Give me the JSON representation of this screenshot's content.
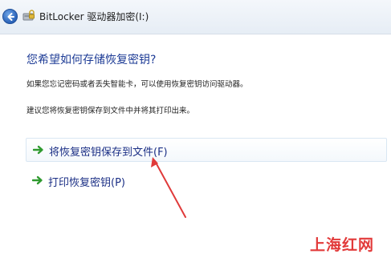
{
  "window": {
    "title": "BitLocker 驱动器加密(I:)",
    "back_icon": "back-arrow-icon",
    "app_icon": "bitlocker-icon"
  },
  "main": {
    "heading": "您希望如何存储恢复密钥?",
    "para1": "如果您忘记密码或者丢失智能卡，可以使用恢复密钥访问驱动器。",
    "para2": "建议您将恢复密钥保存到文件中并将其打印出来。",
    "options": [
      {
        "label": "将恢复密钥保存到文件(F)",
        "icon": "green-arrow-icon",
        "selected": true
      },
      {
        "label": "打印恢复密钥(P)",
        "icon": "green-arrow-icon",
        "selected": false
      }
    ]
  },
  "annotation": {
    "color": "#e03a3a"
  },
  "watermark": {
    "text": "上海红网"
  },
  "colors": {
    "heading": "#1e3c96",
    "link": "#1b2f85",
    "arrow_green": "#2f9a2f"
  }
}
